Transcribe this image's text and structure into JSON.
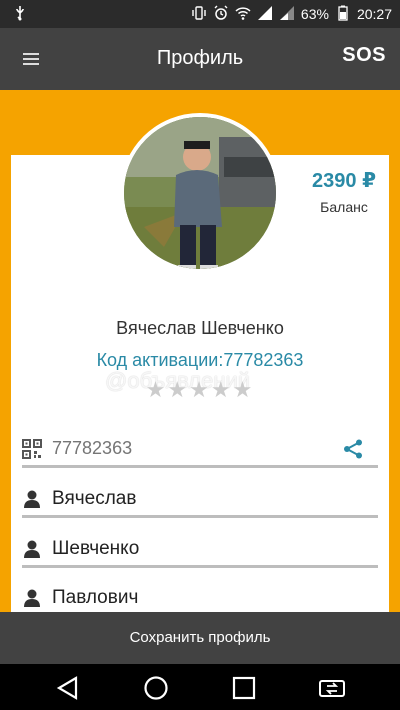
{
  "status_bar": {
    "battery_percent": "63%",
    "time": "20:27"
  },
  "app_bar": {
    "title": "Профиль",
    "sos_label": "SOS"
  },
  "profile": {
    "balance_amount": "2390 ₽",
    "balance_label": "Баланс",
    "full_name": "Вячеслав Шевченко",
    "activation_label": "Код активации:77782363",
    "rating": 0,
    "rating_max": 5,
    "watermark": "@объявлений"
  },
  "fields": {
    "activation_code": {
      "value": "",
      "placeholder": "77782363"
    },
    "first_name": "Вячеслав",
    "last_name": "Шевченко",
    "patronymic": "Павлович"
  },
  "actions": {
    "save_label": "Сохранить профиль"
  },
  "colors": {
    "accent": "#f5a300",
    "link": "#2a8aa6",
    "bar": "#424242"
  }
}
